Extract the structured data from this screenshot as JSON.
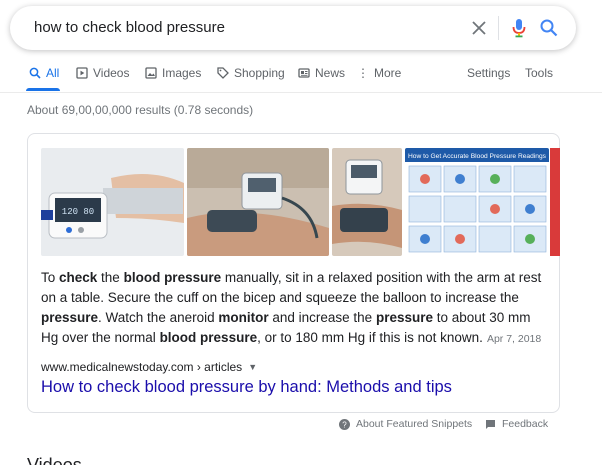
{
  "search": {
    "query": "how to check blood pressure",
    "clear_icon": "close-icon",
    "mic_icon": "microphone-icon",
    "search_icon": "search-icon"
  },
  "tabs": [
    {
      "label": "All",
      "icon": "search-icon"
    },
    {
      "label": "Videos",
      "icon": "video-icon"
    },
    {
      "label": "Images",
      "icon": "image-icon"
    },
    {
      "label": "Shopping",
      "icon": "tag-icon"
    },
    {
      "label": "News",
      "icon": "newspaper-icon"
    },
    {
      "label": "More",
      "icon": "more-dots-icon"
    }
  ],
  "tools": {
    "settings": "Settings",
    "tools": "Tools"
  },
  "result_stats": "About 69,00,00,000 results (0.78 seconds)",
  "featured": {
    "images": [
      {
        "alt": "blood pressure monitor on arm"
      },
      {
        "alt": "person measuring blood pressure"
      },
      {
        "alt": "blood pressure cuff on arm"
      },
      {
        "alt": "blood pressure readings guide"
      }
    ],
    "image_guide_heading": "How to Get Accurate Blood Pressure Readings",
    "monitor_display": "120 80",
    "snippet_parts": [
      {
        "t": "To ",
        "b": false
      },
      {
        "t": "check",
        "b": true
      },
      {
        "t": " the ",
        "b": false
      },
      {
        "t": "blood pressure",
        "b": true
      },
      {
        "t": " manually, sit in a relaxed position with the arm at rest on a table. Secure the cuff on the bicep and squeeze the balloon to increase the ",
        "b": false
      },
      {
        "t": "pressure",
        "b": true
      },
      {
        "t": ". Watch the aneroid ",
        "b": false
      },
      {
        "t": "monitor",
        "b": true
      },
      {
        "t": " and increase the ",
        "b": false
      },
      {
        "t": "pressure",
        "b": true
      },
      {
        "t": " to about 30 mm Hg over the normal ",
        "b": false
      },
      {
        "t": "blood pressure",
        "b": true
      },
      {
        "t": ", or to 180 mm Hg if this is not known.",
        "b": false
      }
    ],
    "date": "Apr 7, 2018",
    "cite": "www.medicalnewstoday.com › articles",
    "title": "How to check blood pressure by hand: Methods and tips"
  },
  "footer": {
    "about": "About Featured Snippets",
    "feedback": "Feedback"
  },
  "section_heading": "Videos",
  "colors": {
    "accent": "#1a73e8",
    "link": "#1a0dab",
    "muted": "#70757a"
  }
}
